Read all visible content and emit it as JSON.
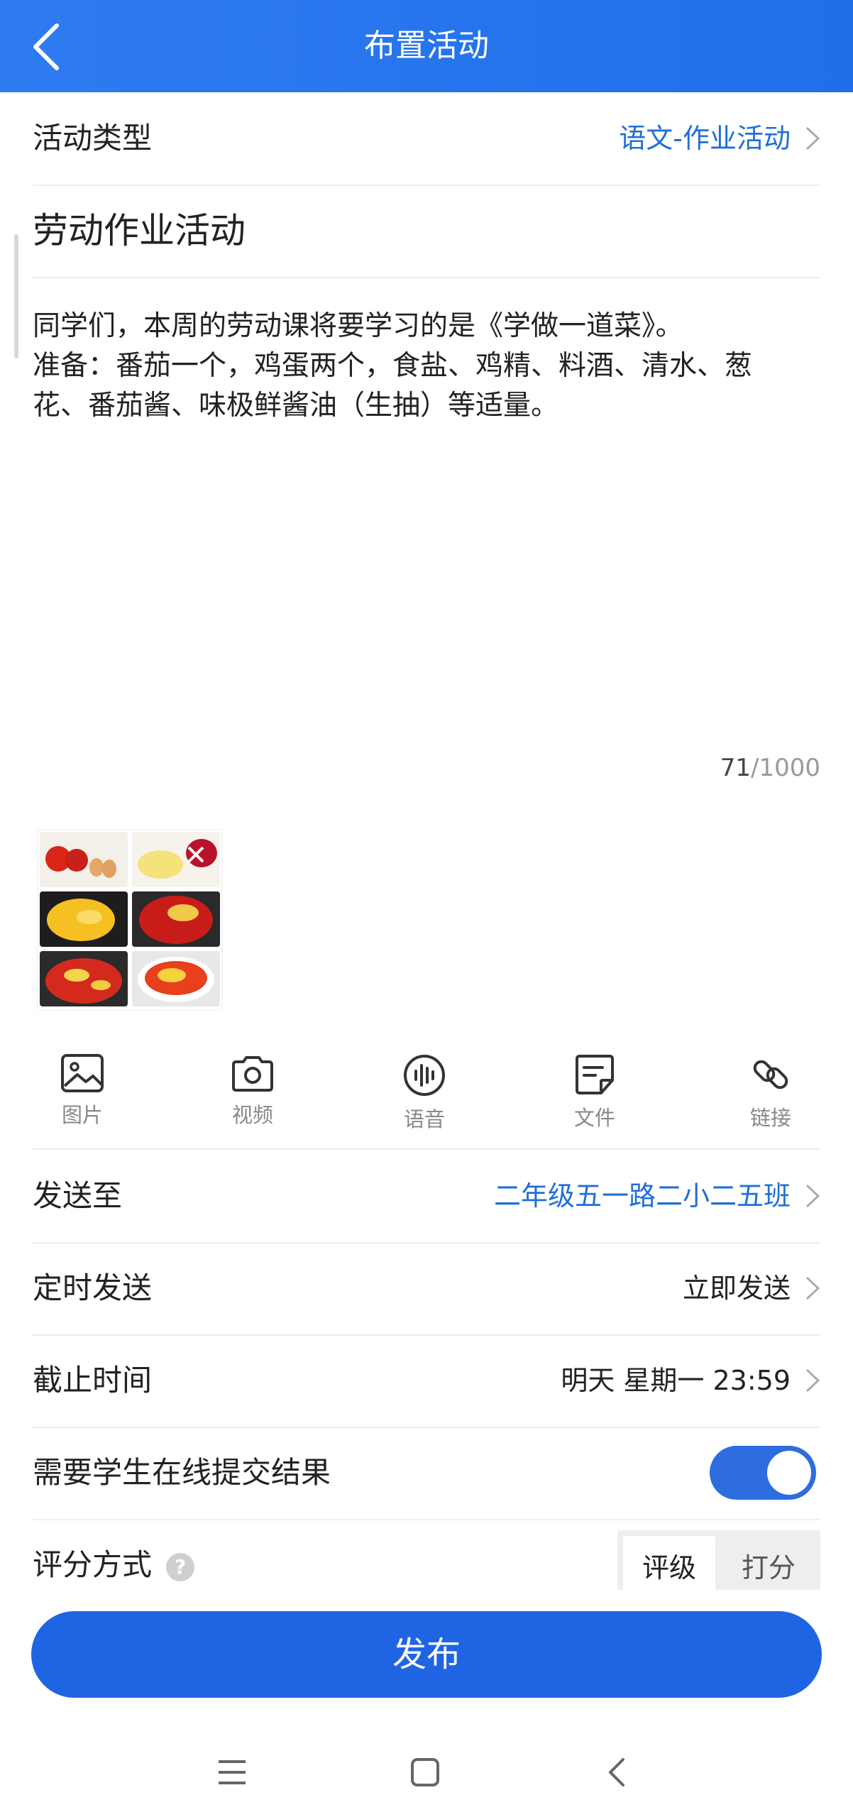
{
  "header": {
    "title": "布置活动"
  },
  "activity_type": {
    "label": "活动类型",
    "value": "语文-作业活动"
  },
  "activity_title": "劳动作业活动",
  "description_lines": [
    "同学们，本周的劳动课将要学习的是《学做一道菜》。",
    "准备：番茄一个，鸡蛋两个，食盐、鸡精、料酒、清水、葱",
    "花、番茄酱、味极鲜酱油（生抽）等适量。"
  ],
  "char_count": {
    "current": "71",
    "max": "/1000"
  },
  "toolbar": [
    {
      "icon": "image-icon",
      "label": "图片"
    },
    {
      "icon": "camera-icon",
      "label": "视频"
    },
    {
      "icon": "audio-icon",
      "label": "语音"
    },
    {
      "icon": "file-icon",
      "label": "文件"
    },
    {
      "icon": "link-icon",
      "label": "链接"
    }
  ],
  "send_to": {
    "label": "发送至",
    "value": "二年级五一路二小二五班"
  },
  "schedule": {
    "label": "定时发送",
    "value": "立即发送"
  },
  "deadline": {
    "label": "截止时间",
    "value": "明天 星期一 23:59"
  },
  "online_submit": {
    "label": "需要学生在线提交结果",
    "enabled": true
  },
  "grading": {
    "label": "评分方式",
    "help_icon": "?",
    "options": [
      "评级",
      "打分"
    ],
    "selected": "评级"
  },
  "publish_button": "发布",
  "colors": {
    "primary": "#1f65e3",
    "link_blue": "#1f6fd9",
    "header": "#2f7bf0"
  }
}
